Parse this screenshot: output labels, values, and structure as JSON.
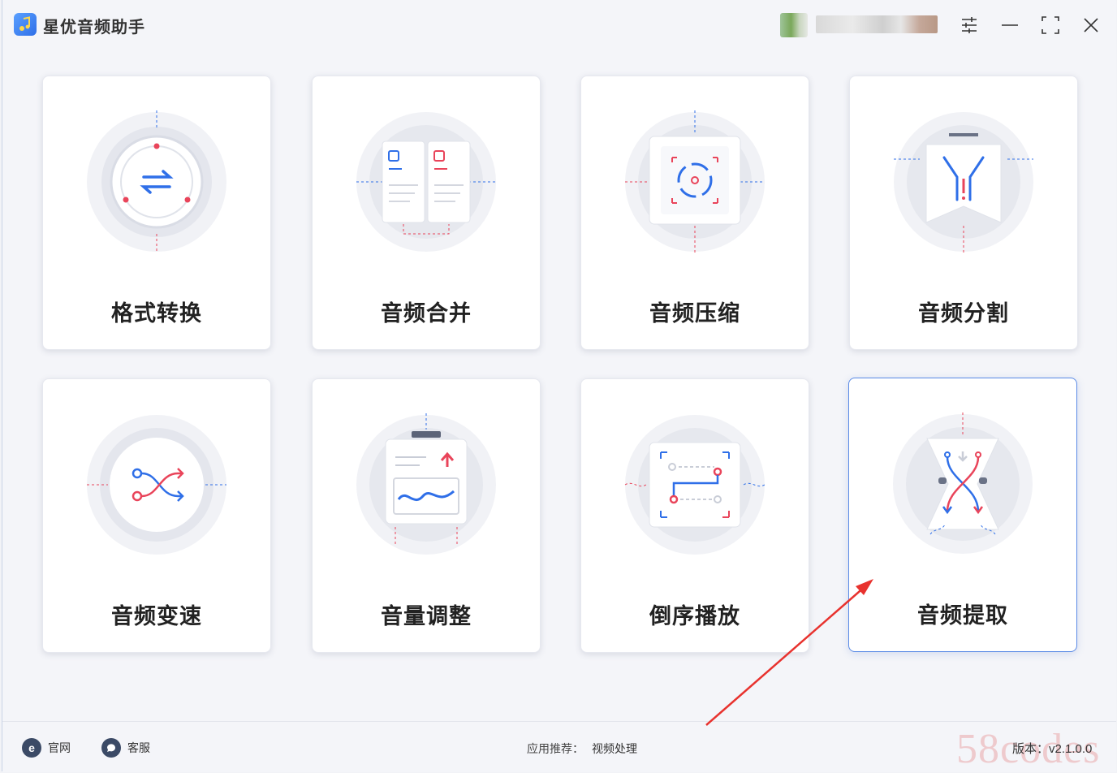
{
  "app": {
    "title": "星优音频助手"
  },
  "tools": [
    {
      "label": "格式转换",
      "icon": "format-convert-icon"
    },
    {
      "label": "音频合并",
      "icon": "audio-merge-icon"
    },
    {
      "label": "音频压缩",
      "icon": "audio-compress-icon"
    },
    {
      "label": "音频分割",
      "icon": "audio-split-icon"
    },
    {
      "label": "音频变速",
      "icon": "audio-speed-icon"
    },
    {
      "label": "音量调整",
      "icon": "volume-adjust-icon"
    },
    {
      "label": "倒序播放",
      "icon": "reverse-play-icon"
    },
    {
      "label": "音频提取",
      "icon": "audio-extract-icon",
      "selected": true
    }
  ],
  "footer": {
    "website": "官网",
    "support": "客服",
    "recommend_label": "应用推荐：",
    "recommend_link": "视频处理",
    "version": "版本：v2.1.0.0",
    "watermark": "58codes"
  },
  "colors": {
    "accent": "#2f6fe8",
    "red": "#e9445a",
    "selected_border": "#5b8be6"
  }
}
